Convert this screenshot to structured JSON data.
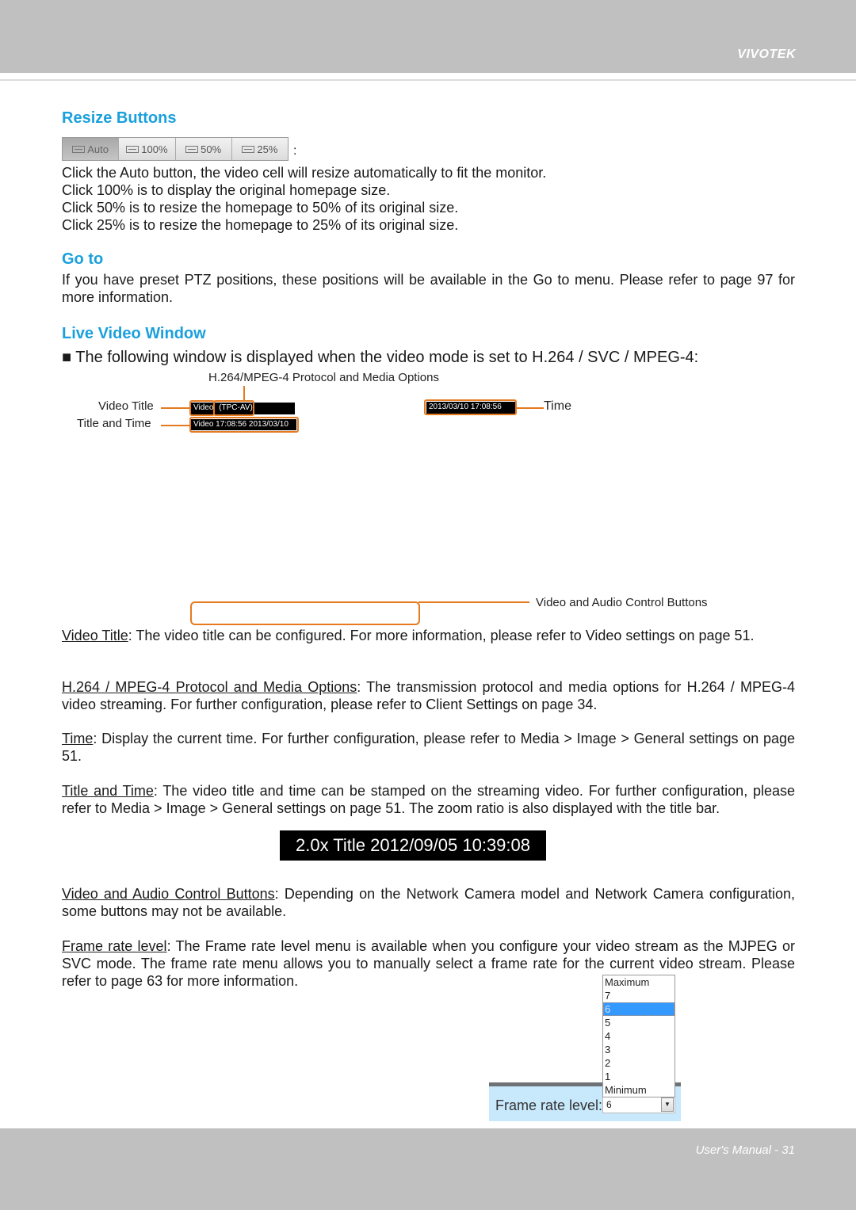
{
  "header": {
    "brand": "VIVOTEK"
  },
  "resize": {
    "heading": "Resize Buttons",
    "buttons": [
      {
        "label": "Auto",
        "active": true
      },
      {
        "label": "100%"
      },
      {
        "label": "50%"
      },
      {
        "label": "25%"
      }
    ],
    "colon": ":",
    "lines": [
      "Click the Auto button, the video cell will resize automatically to fit the monitor.",
      "Click 100% is to display the original homepage size.",
      "Click 50% is to resize the homepage to 50% of its original size.",
      "Click 25% is to resize the homepage to 25% of its original size."
    ]
  },
  "goto": {
    "heading": "Go to",
    "text": "If you have preset PTZ positions, these positions will be available in the Go to menu. Please refer to page 97 for more information."
  },
  "live": {
    "heading": "Live Video Window",
    "intro": "■ The following window is displayed when the video mode is set to H.264 / SVC / MPEG-4:",
    "diagram": {
      "protocol_label": "H.264/MPEG-4 Protocol and Media Options",
      "video_title_label": "Video Title",
      "title_time_label": "Title and Time",
      "time_label": "Time",
      "controls_label": "Video and Audio Control Buttons",
      "bar_title": "Video",
      "bar_protocol": "(TPC-AV)",
      "bar_title_time": "Video 17:08:56  2013/03/10",
      "bar_time": "2013/03/10  17:08:56"
    }
  },
  "descriptions": [
    {
      "term": "Video Title",
      "text": ": The video title can be configured. For more information, please refer to Video settings on page 51."
    },
    {
      "term": "H.264 / MPEG-4 Protocol and Media Options",
      "text": ": The transmission protocol and media options for H.264 / MPEG-4 video streaming. For further configuration, please refer to Client Settings on page 34."
    },
    {
      "term": "Time",
      "text": ": Display the current time. For further configuration, please refer to Media > Image > General settings on page 51."
    },
    {
      "term": "Title and Time",
      "text": ": The video title and time can be stamped on the streaming video. For further configuration, please refer to Media > Image > General settings on page 51. The zoom ratio is also displayed with the title bar."
    },
    {
      "term": "Video and Audio Control Buttons",
      "text": ": Depending on the Network Camera model and Network Camera configuration, some buttons may not be available."
    },
    {
      "term": "Frame rate level",
      "text": ": The Frame rate level menu is available when you configure your video stream as the MJPEG or SVC mode. The frame rate menu allows you to manually select a frame rate for the current video stream. Please refer to page 63 for more information."
    }
  ],
  "stamp": {
    "text": "2.0x Title 2012/09/05 10:39:08"
  },
  "frame_rate": {
    "label": "Frame rate level:",
    "selected": "6",
    "options": [
      "Maximum",
      "7",
      "6",
      "5",
      "4",
      "3",
      "2",
      "1",
      "Minimum"
    ],
    "highlight_index": 2
  },
  "footer": {
    "text": "User's Manual - 31"
  }
}
